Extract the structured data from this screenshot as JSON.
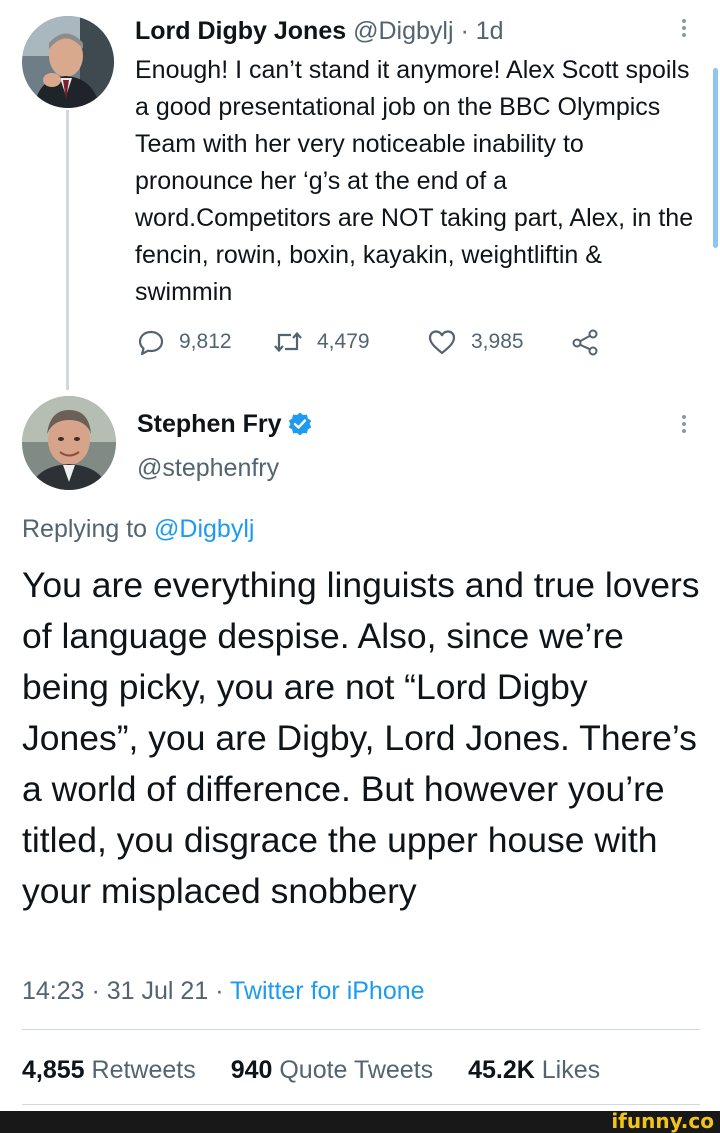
{
  "tweet1": {
    "name": "Lord Digby Jones",
    "handle": "@Digbylj",
    "age": "· 1d",
    "text": "Enough! I can’t stand it anymore! Alex Scott spoils a good presentational job on the BBC Olympics Team with her very noticeable inability to pronounce her ‘g’s at the end of a word.Competitors are NOT taking part, Alex, in the fencin, rowin, boxin, kayakin, weightliftin & swimmin",
    "replies": "9,812",
    "retweets": "4,479",
    "likes": "3,985"
  },
  "tweet2": {
    "name": "Stephen Fry",
    "handle": "@stephenfry",
    "replying_prefix": "Replying to",
    "replying_to": "@Digbylj",
    "text": "You are everything linguists and true lovers of language despise. Also, since we’re being picky, you are not “Lord Digby Jones”, you are  Digby, Lord Jones. There’s a world of difference. But however you’re titled, you disgrace the upper house with your misplaced snobbery",
    "time": "14:23 · 31 Jul 21 ·",
    "source": "Twitter for iPhone",
    "stats": {
      "retweets_count": "4,855",
      "retweets_label": "Retweets",
      "quotes_count": "940",
      "quotes_label": "Quote Tweets",
      "likes_count": "45.2K",
      "likes_label": "Likes"
    }
  },
  "watermark": "ifunny.co",
  "colors": {
    "accent": "#1d9bf0",
    "secondary_text": "#536471",
    "watermark": "#f2c41a"
  },
  "icons": [
    "reply-icon",
    "retweet-icon",
    "like-icon",
    "share-icon",
    "verified-icon",
    "more-icon"
  ]
}
